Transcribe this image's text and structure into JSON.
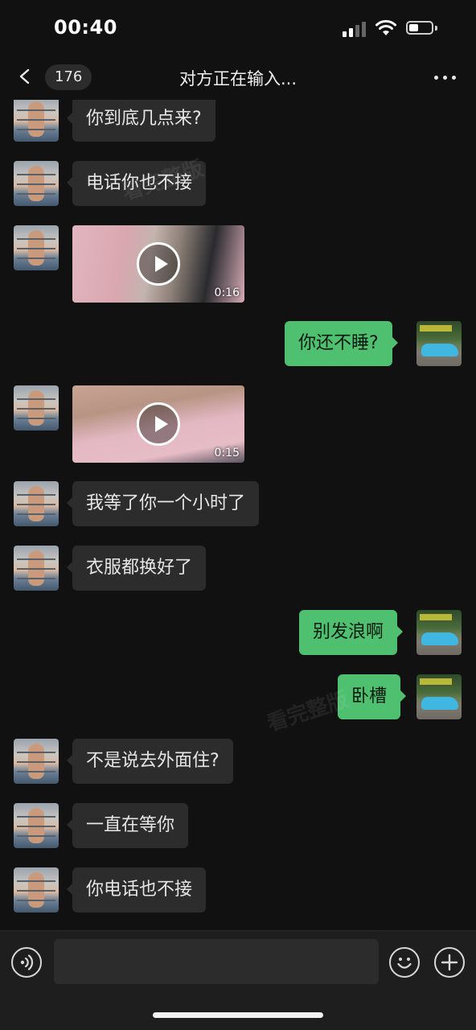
{
  "status_bar": {
    "time": "00:40",
    "icons": [
      "signal-icon",
      "wifi-icon",
      "battery-icon"
    ]
  },
  "nav": {
    "back_icon": "chevron-left-icon",
    "unread_count": "176",
    "title": "对方正在输入...",
    "more_icon": "more-dots-icon"
  },
  "messages": [
    {
      "type": "text",
      "from": "them",
      "text": "你到底几点来?"
    },
    {
      "type": "text",
      "from": "them",
      "text": "电话你也不接"
    },
    {
      "type": "video",
      "from": "them",
      "duration": "0:16"
    },
    {
      "type": "text",
      "from": "me",
      "text": "你还不睡?"
    },
    {
      "type": "video",
      "from": "them",
      "duration": "0:15"
    },
    {
      "type": "text",
      "from": "them",
      "text": "我等了你一个小时了"
    },
    {
      "type": "text",
      "from": "them",
      "text": "衣服都换好了"
    },
    {
      "type": "text",
      "from": "me",
      "text": "别发浪啊"
    },
    {
      "type": "text",
      "from": "me",
      "text": "卧槽"
    },
    {
      "type": "text",
      "from": "them",
      "text": "不是说去外面住?"
    },
    {
      "type": "text",
      "from": "them",
      "text": "一直在等你"
    },
    {
      "type": "text",
      "from": "them",
      "text": "你电话也不接"
    }
  ],
  "watermarks": [
    "看完整版",
    "看完整版"
  ],
  "input_bar": {
    "voice_icon": "voice-icon",
    "input_value": "",
    "emoji_icon": "emoji-icon",
    "plus_icon": "plus-icon"
  },
  "colors": {
    "background": "#111111",
    "incoming_bubble": "#2c2c2c",
    "outgoing_bubble": "#4fbf70",
    "input_bar": "#1e1e1e"
  }
}
